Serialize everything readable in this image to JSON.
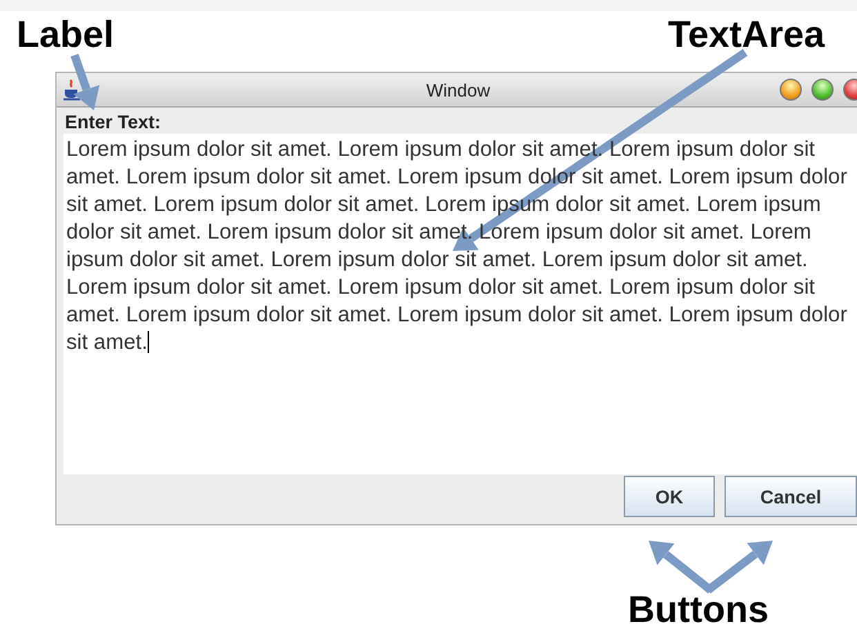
{
  "annotations": [
    {
      "kind": "label",
      "text": "Label"
    },
    {
      "kind": "textarea",
      "text": "TextArea"
    },
    {
      "kind": "buttons",
      "text": "Buttons"
    }
  ],
  "window": {
    "title": "Window"
  },
  "label": "Enter Text:",
  "text_area": {
    "value": "Lorem ipsum dolor sit amet. Lorem ipsum dolor sit amet. Lorem ipsum dolor sit amet. Lorem ipsum dolor sit amet. Lorem ipsum dolor sit amet. Lorem ipsum dolor sit amet. Lorem ipsum dolor sit amet. Lorem ipsum dolor sit amet. Lorem ipsum dolor sit amet. Lorem ipsum dolor sit amet. Lorem ipsum dolor sit amet. Lorem ipsum dolor sit amet. Lorem ipsum dolor sit amet. Lorem ipsum dolor sit amet. Lorem ipsum dolor sit amet. Lorem ipsum dolor sit amet. Lorem ipsum dolor sit amet. Lorem ipsum dolor sit amet. Lorem ipsum dolor sit amet. Lorem ipsum dolor sit amet."
  },
  "buttons": [
    "OK",
    "Cancel"
  ]
}
